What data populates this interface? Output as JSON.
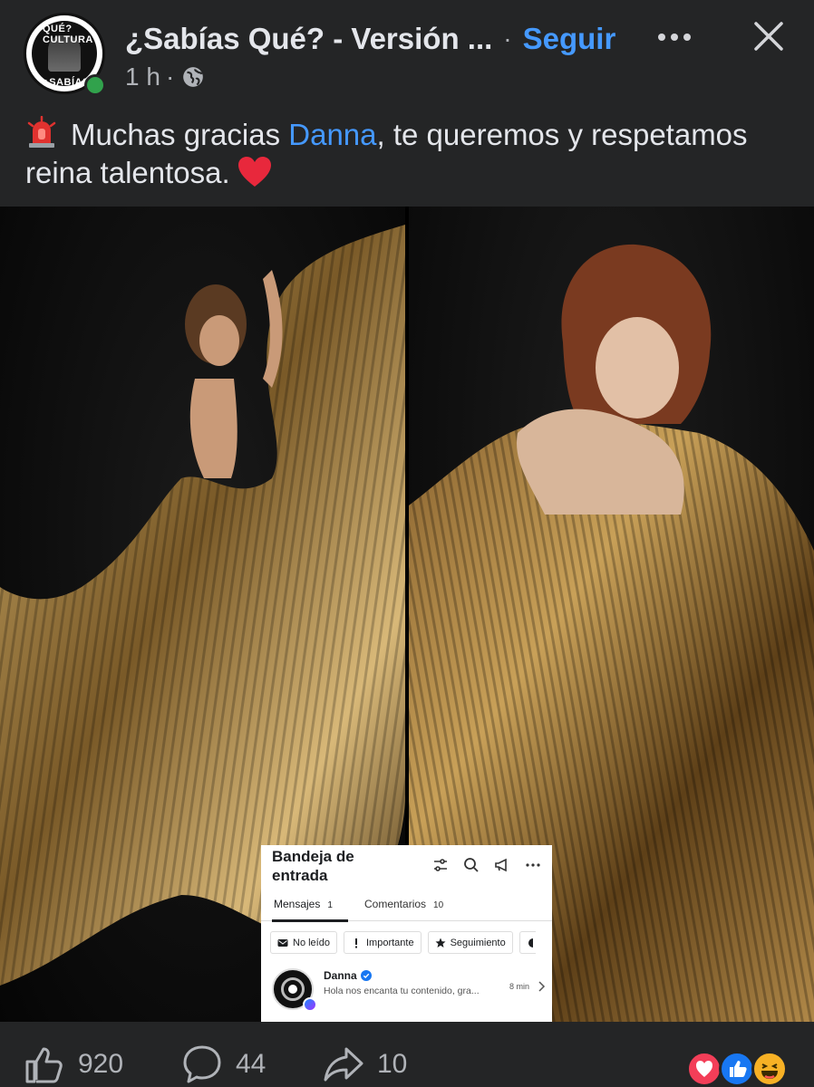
{
  "post": {
    "page_name": "¿Sabías Qué? - Versión ...",
    "separator": "·",
    "follow_label": "Seguir",
    "time": "1 h",
    "time_sep": "·",
    "avatar_text_top": "QUÉ? CULTURA",
    "avatar_text_bottom": "¿SABÍAS P?",
    "caption_before": "Muchas gracias ",
    "caption_mention": "Danna",
    "caption_after": ", te queremos y respetamos reina talentosa."
  },
  "inbox": {
    "title": "Bandeja de entrada",
    "tabs": [
      {
        "label": "Mensajes",
        "count": "1"
      },
      {
        "label": "Comentarios",
        "count": "10"
      }
    ],
    "filters": [
      "No leído",
      "Importante",
      "Seguimiento"
    ],
    "message": {
      "sender": "Danna",
      "preview": "Hola nos encanta tu contenido, gra...",
      "time": "8 min"
    }
  },
  "footer": {
    "likes": "920",
    "comments": "44",
    "shares": "10"
  },
  "colors": {
    "background": "#242526",
    "accent": "#4599ff",
    "text_primary": "#e4e6eb",
    "text_secondary": "#b0b3b8",
    "online": "#31a24c"
  },
  "icons": {
    "header": [
      "globe-icon",
      "more-icon",
      "close-icon"
    ],
    "caption": [
      "siren-icon",
      "heart-emoji"
    ],
    "footer": [
      "like-icon",
      "comment-icon",
      "share-icon",
      "love-reaction",
      "like-reaction",
      "haha-reaction"
    ]
  }
}
